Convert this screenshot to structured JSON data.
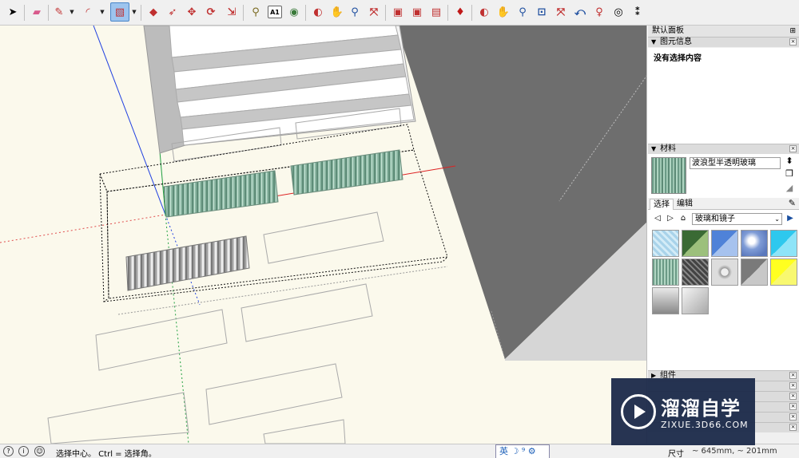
{
  "toolbar": {
    "tools": [
      {
        "name": "select-tool",
        "glyph": "➤"
      },
      {
        "name": "eraser-tool",
        "glyph": "▰"
      },
      {
        "name": "line-tool",
        "glyph": "✎"
      },
      {
        "name": "arc-tool",
        "glyph": "◜"
      },
      {
        "name": "rectangle-tool",
        "glyph": "▧"
      },
      {
        "name": "push-pull-tool",
        "glyph": "◆"
      },
      {
        "name": "follow-me-tool",
        "glyph": "➶"
      },
      {
        "name": "move-tool",
        "glyph": "✥"
      },
      {
        "name": "rotate-tool",
        "glyph": "⟳"
      },
      {
        "name": "scale-tool",
        "glyph": "⇲"
      },
      {
        "name": "tape-measure-tool",
        "glyph": "⚲"
      },
      {
        "name": "text-tool",
        "glyph": "A1"
      },
      {
        "name": "paint-bucket-tool",
        "glyph": "◉"
      },
      {
        "name": "orbit-tool",
        "glyph": "◐"
      },
      {
        "name": "pan-tool",
        "glyph": "✋"
      },
      {
        "name": "zoom-tool",
        "glyph": "🔍"
      },
      {
        "name": "zoom-extents-tool",
        "glyph": "⤧"
      },
      {
        "name": "get-models-icon",
        "glyph": "▣"
      },
      {
        "name": "share-model-icon",
        "glyph": "▣"
      },
      {
        "name": "extension-warehouse-icon",
        "glyph": "▤"
      },
      {
        "name": "ruby-console-icon",
        "glyph": "♦"
      },
      {
        "name": "orbit-view-tool",
        "glyph": "◐"
      },
      {
        "name": "pan-view-tool",
        "glyph": "✋"
      },
      {
        "name": "zoom-view-tool",
        "glyph": "🔍"
      },
      {
        "name": "zoom-window-tool",
        "glyph": "⊡"
      },
      {
        "name": "zoom-extents-view-tool",
        "glyph": "⤧"
      },
      {
        "name": "previous-view-tool",
        "glyph": "⤺"
      },
      {
        "name": "position-camera-tool",
        "glyph": "♀"
      },
      {
        "name": "look-around-tool",
        "glyph": "◎"
      },
      {
        "name": "walk-tool",
        "glyph": "👣"
      }
    ]
  },
  "panel": {
    "tray_title": "默认面板",
    "pin_glyph": "⊞",
    "entity_info": {
      "title": "图元信息",
      "content": "没有选择内容"
    },
    "materials": {
      "title": "材料",
      "name_value": "波浪型半透明玻璃",
      "tab_select": "选择",
      "tab_edit": "编辑",
      "library": "玻璃和镜子",
      "swatch_colors": [
        "#b9dcee",
        "#2e5e2a",
        "#5d8ede",
        "#8fa8d8",
        "#36d4f2",
        "#7aa894",
        "#555555",
        "#c4c4c4",
        "#9a9a9a",
        "#ffff33",
        "#b8b8b8",
        "#d8d8d8"
      ]
    },
    "components": {
      "title": "组件"
    }
  },
  "statusbar": {
    "message": "选择中心。 Ctrl = 选择角。",
    "ime": "英 ☽ ⁹ ⚙",
    "dim_label": "尺寸",
    "dim_value": "~ 645mm, ~ 201mm"
  },
  "watermark": {
    "title": "溜溜自学",
    "subtitle": "ZIXUE.3D66.COM"
  }
}
